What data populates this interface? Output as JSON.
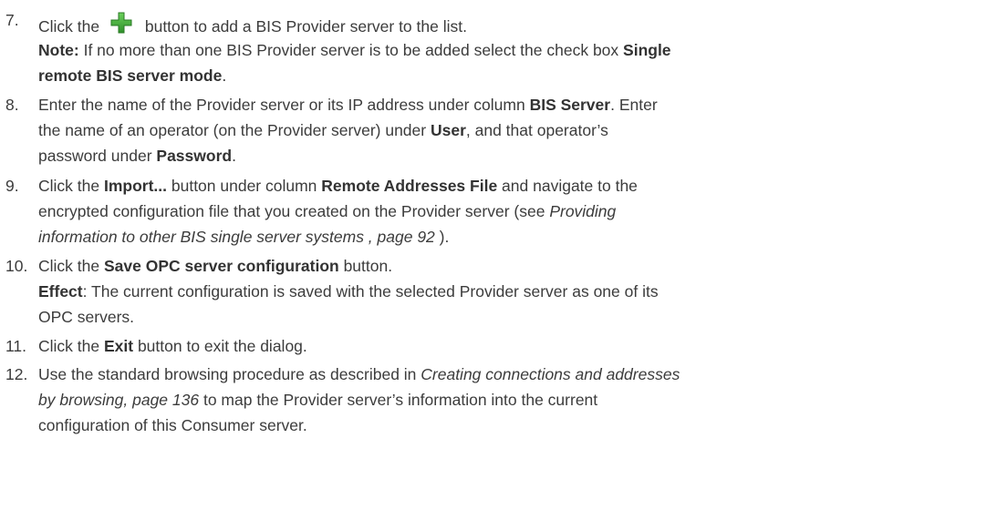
{
  "steps": [
    {
      "number": "7.",
      "parts": {
        "a": "Click the",
        "b": "button to add a BIS Provider server to the list.",
        "note_label": "Note:",
        "note_a": " If no more than one BIS Provider server is to be added select the check box ",
        "note_b": "Single",
        "note_c": "remote BIS server mode",
        "note_d": "."
      },
      "icon": "green-plus-icon"
    },
    {
      "number": "8.",
      "parts": {
        "a": "Enter the name of the Provider server or its IP address under column ",
        "b": "BIS Server",
        "c": ". Enter",
        "d": "the name of an operator (on the Provider server) under ",
        "e": "User",
        "f": ", and that operator’s",
        "g": "password under ",
        "h": "Password",
        "i": "."
      }
    },
    {
      "number": "9.",
      "parts": {
        "a": "Click the ",
        "b": "Import...",
        "c": " button under column ",
        "d": "Remote Addresses File",
        "e": " and navigate to the",
        "f": "encrypted configuration file that you created on the Provider server (see ",
        "g": "Providing",
        "h": "information to other BIS single server systems , page 92",
        "i": " )."
      }
    },
    {
      "number": "10.",
      "parts": {
        "a": "Click the ",
        "b": "Save OPC server configuration",
        "c": " button.",
        "effect_label": "Effect",
        "effect_a": ": The current configuration is saved with the selected Provider server as one of its",
        "effect_b": "OPC servers."
      }
    },
    {
      "number": "11.",
      "parts": {
        "a": "Click the ",
        "b": "Exit",
        "c": " button to exit the dialog."
      }
    },
    {
      "number": "12.",
      "parts": {
        "a": "Use the standard browsing procedure as described in ",
        "b": "Creating connections and addresses",
        "c": "by browsing, page 136",
        "d": " to map the Provider server’s information into the current",
        "e": "configuration of this Consumer server."
      }
    }
  ],
  "colors": {
    "text": "#3c3c3c",
    "icon_green": "#3aa635"
  }
}
